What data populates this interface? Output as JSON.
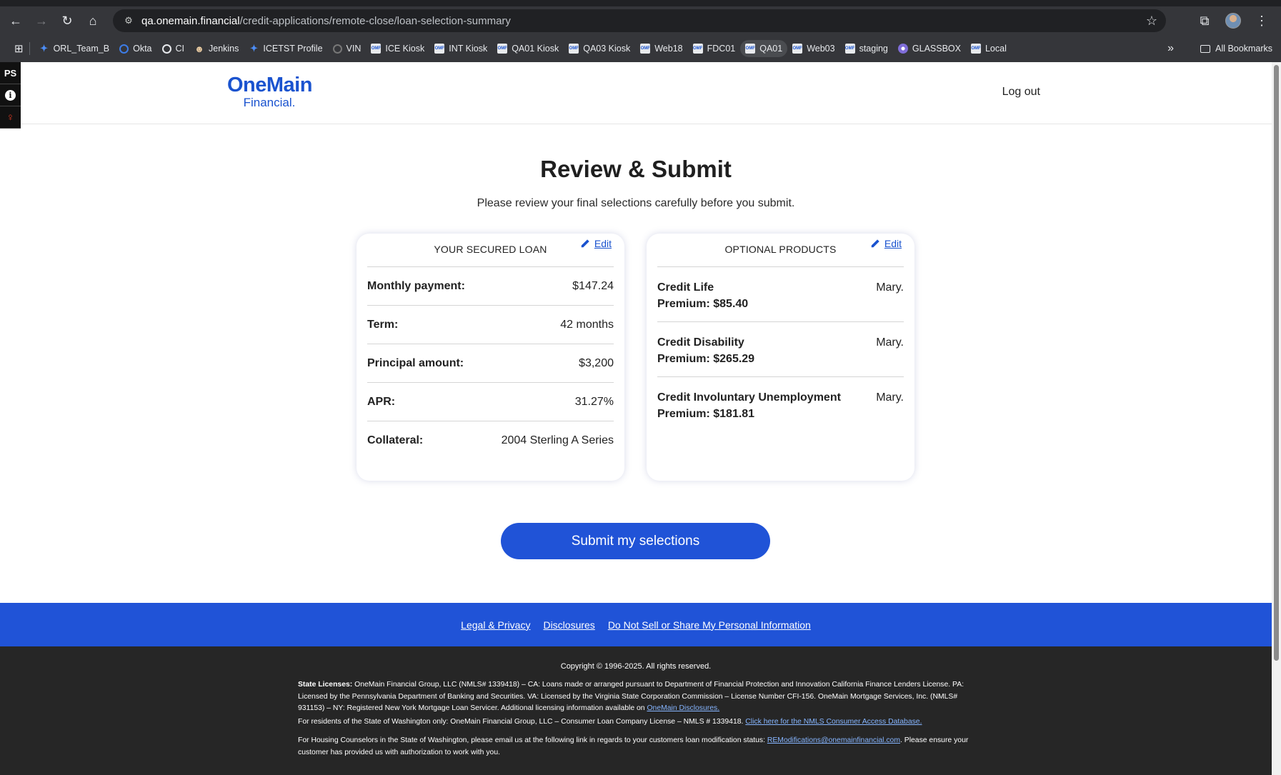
{
  "browser": {
    "url_host": "qa.onemain.financial",
    "url_path": "/credit-applications/remote-close/loan-selection-summary",
    "bookmarks": [
      {
        "label": "ORL_Team_B",
        "icon": "jira-icon"
      },
      {
        "label": "Okta",
        "icon": "okta-icon"
      },
      {
        "label": "CI",
        "icon": "ci-icon"
      },
      {
        "label": "Jenkins",
        "icon": "jenkins-icon"
      },
      {
        "label": "ICETST Profile",
        "icon": "confluence-icon"
      },
      {
        "label": "VIN",
        "icon": "github-icon"
      },
      {
        "label": "ICE Kiosk",
        "icon": "omf-icon"
      },
      {
        "label": "INT Kiosk",
        "icon": "omf-icon"
      },
      {
        "label": "QA01 Kiosk",
        "icon": "omf-icon"
      },
      {
        "label": "QA03 Kiosk",
        "icon": "omf-icon"
      },
      {
        "label": "Web18",
        "icon": "omf-icon"
      },
      {
        "label": "FDC01",
        "icon": "omf-icon"
      },
      {
        "label": "QA01",
        "icon": "omf-icon"
      },
      {
        "label": "Web03",
        "icon": "omf-icon"
      },
      {
        "label": "staging",
        "icon": "omf-icon"
      },
      {
        "label": "GLASSBOX",
        "icon": "glassbox-icon"
      },
      {
        "label": "Local",
        "icon": "omf-icon"
      }
    ],
    "all_bookmarks": "All Bookmarks"
  },
  "extensions": {
    "ps": "PS"
  },
  "header": {
    "logo_line1": "OneMain",
    "logo_line2": "Financial.",
    "logout": "Log out"
  },
  "page": {
    "title": "Review & Submit",
    "subtitle": "Please review your final selections carefully before you submit."
  },
  "loan_card": {
    "title": "YOUR SECURED LOAN",
    "edit": "Edit",
    "rows": [
      {
        "label": "Monthly payment:",
        "value": "$147.24"
      },
      {
        "label": "Term:",
        "value": "42 months"
      },
      {
        "label": "Principal amount:",
        "value": "$3,200"
      },
      {
        "label": "APR:",
        "value": "31.27%"
      },
      {
        "label": "Collateral:",
        "value": "2004 Sterling A Series"
      }
    ]
  },
  "products_card": {
    "title": "OPTIONAL PRODUCTS",
    "edit": "Edit",
    "items": [
      {
        "name": "Credit Life",
        "premium": "Premium: $85.40",
        "value": "Mary."
      },
      {
        "name": "Credit Disability",
        "premium": "Premium: $265.29",
        "value": "Mary."
      },
      {
        "name": "Credit Involuntary Unemployment",
        "premium": "Premium: $181.81",
        "value": "Mary."
      }
    ]
  },
  "submit_label": "Submit my selections",
  "footer": {
    "links": [
      "Legal & Privacy",
      "Disclosures",
      "Do Not Sell or Share My Personal Information"
    ],
    "copyright": "Copyright © 1996-2025. All rights reserved.",
    "state_licenses_label": "State Licenses:",
    "state_licenses_text": " OneMain Financial Group, LLC (NMLS# 1339418) – CA: Loans made or arranged pursuant to Department of Financial Protection and Innovation California Finance Lenders License. PA: Licensed by the Pennsylvania Department of Banking and Securities. VA: Licensed by the Virginia State Corporation Commission – License Number CFI-156. OneMain Mortgage Services, Inc. (NMLS# 931153) – NY: Registered New York Mortgage Loan Servicer. Additional licensing information available on ",
    "disclosures_link": "OneMain Disclosures.",
    "washington_text": "For residents of the State of Washington only: OneMain Financial Group, LLC – Consumer Loan Company License – NMLS # 1339418. ",
    "nmls_link": "Click here for the NMLS Consumer Access Database.",
    "housing_text": "For Housing Counselors in the State of Washington, please email us at the following link in regards to your customers loan modification status: ",
    "email_link": "REModifications@onemainfinancial.com",
    "housing_text2": ". Please ensure your customer has provided us with authorization to work with you."
  },
  "colors": {
    "brand_blue": "#2053d7",
    "link_blue": "#1a53cf",
    "footer_dark": "#262626"
  }
}
